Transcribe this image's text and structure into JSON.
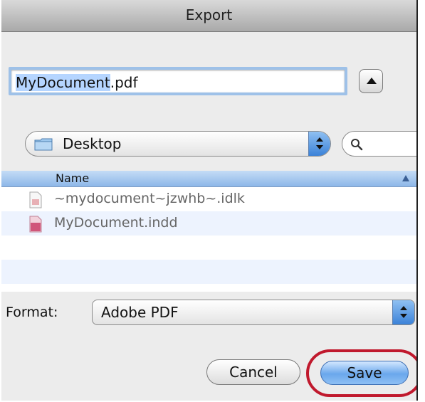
{
  "window": {
    "title": "Export"
  },
  "save_as": {
    "value_selected": "MyDocument",
    "value_rest": ".pdf",
    "expand_icon": "disclosure-triangle-up"
  },
  "location": {
    "label": "Desktop",
    "icon": "folder-icon",
    "stepper_icon": "up-down-arrows"
  },
  "search": {
    "icon": "magnifier-icon",
    "value": ""
  },
  "file_list": {
    "column_header": "Name",
    "sort_icon": "sort-ascending-triangle",
    "files": [
      {
        "name": "~mydocument~jzwhb~.idlk",
        "icon": "lock-file-icon"
      },
      {
        "name": "MyDocument.indd",
        "icon": "indesign-doc-icon"
      }
    ]
  },
  "format": {
    "label": "Format:",
    "value": "Adobe PDF"
  },
  "buttons": {
    "cancel": "Cancel",
    "save": "Save"
  },
  "colors": {
    "highlight": "#c0192d",
    "selection": "#b5d5ff",
    "default_button": "#6aa7ec"
  }
}
